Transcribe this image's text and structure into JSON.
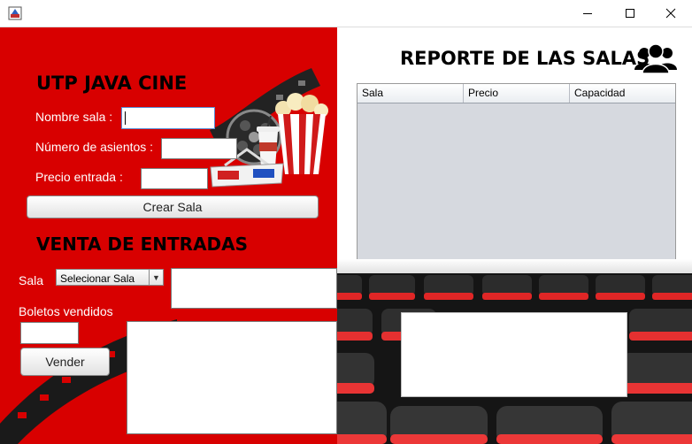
{
  "window": {
    "title": ""
  },
  "left": {
    "title": "UTP JAVA CINE",
    "nombre_label": "Nombre sala :",
    "asientos_label": "Número de asientos :",
    "precio_label": "Precio entrada :",
    "crear_button": "Crear Sala",
    "venta_title": "VENTA DE ENTRADAS",
    "sala_label": "Sala",
    "sala_combo_value": "Selecionar Sala",
    "boletos_label": "Boletos vendidos",
    "vender_button": "Vender"
  },
  "right": {
    "title": "REPORTE DE LAS SALAS",
    "table": {
      "columns": [
        "Sala",
        "Precio",
        "Capacidad"
      ]
    }
  },
  "colors": {
    "accent_red": "#d80000",
    "table_bg": "#d6d9df",
    "seat_red": "#e02626"
  },
  "icons": [
    "app-icon",
    "minimize-icon",
    "maximize-icon",
    "close-icon",
    "users-icon",
    "film-reel-icon",
    "popcorn-icon",
    "drink-cup-icon",
    "3d-glasses-icon",
    "film-strip-icon"
  ]
}
